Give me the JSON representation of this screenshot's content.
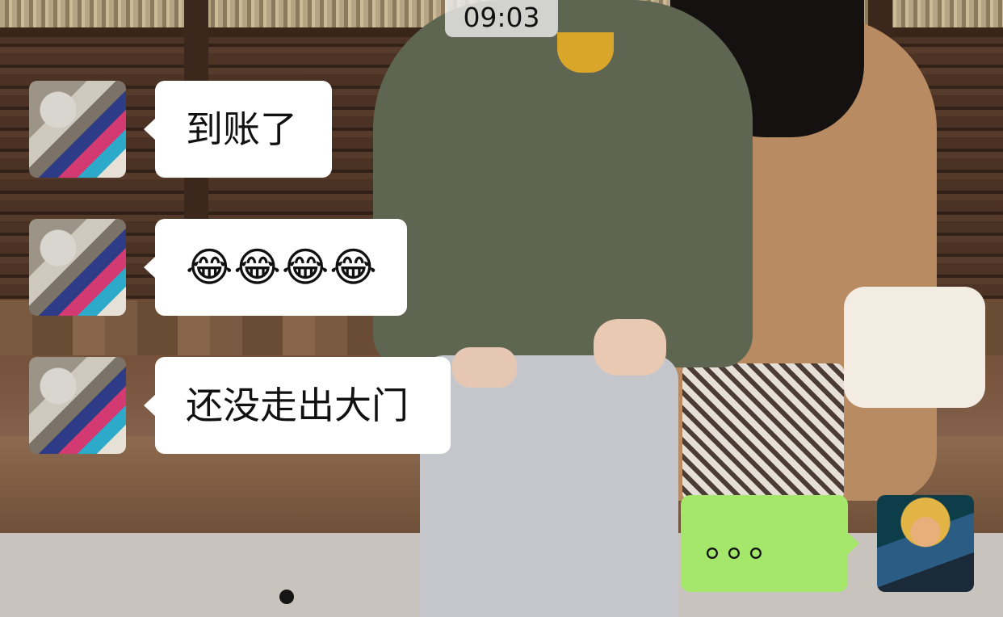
{
  "status_bar": {
    "time": "09:03"
  },
  "messages": [
    {
      "side": "incoming",
      "avatar": "cat-avatar",
      "text": "到账了"
    },
    {
      "side": "incoming",
      "avatar": "cat-avatar",
      "text": "😂😂😂😂"
    },
    {
      "side": "incoming",
      "avatar": "cat-avatar",
      "text": "还没走出大门"
    },
    {
      "side": "outgoing",
      "avatar": "hero-avatar",
      "text": "。。。"
    }
  ],
  "colors": {
    "incoming_bubble": "#ffffff",
    "outgoing_bubble": "#a5e76b"
  }
}
